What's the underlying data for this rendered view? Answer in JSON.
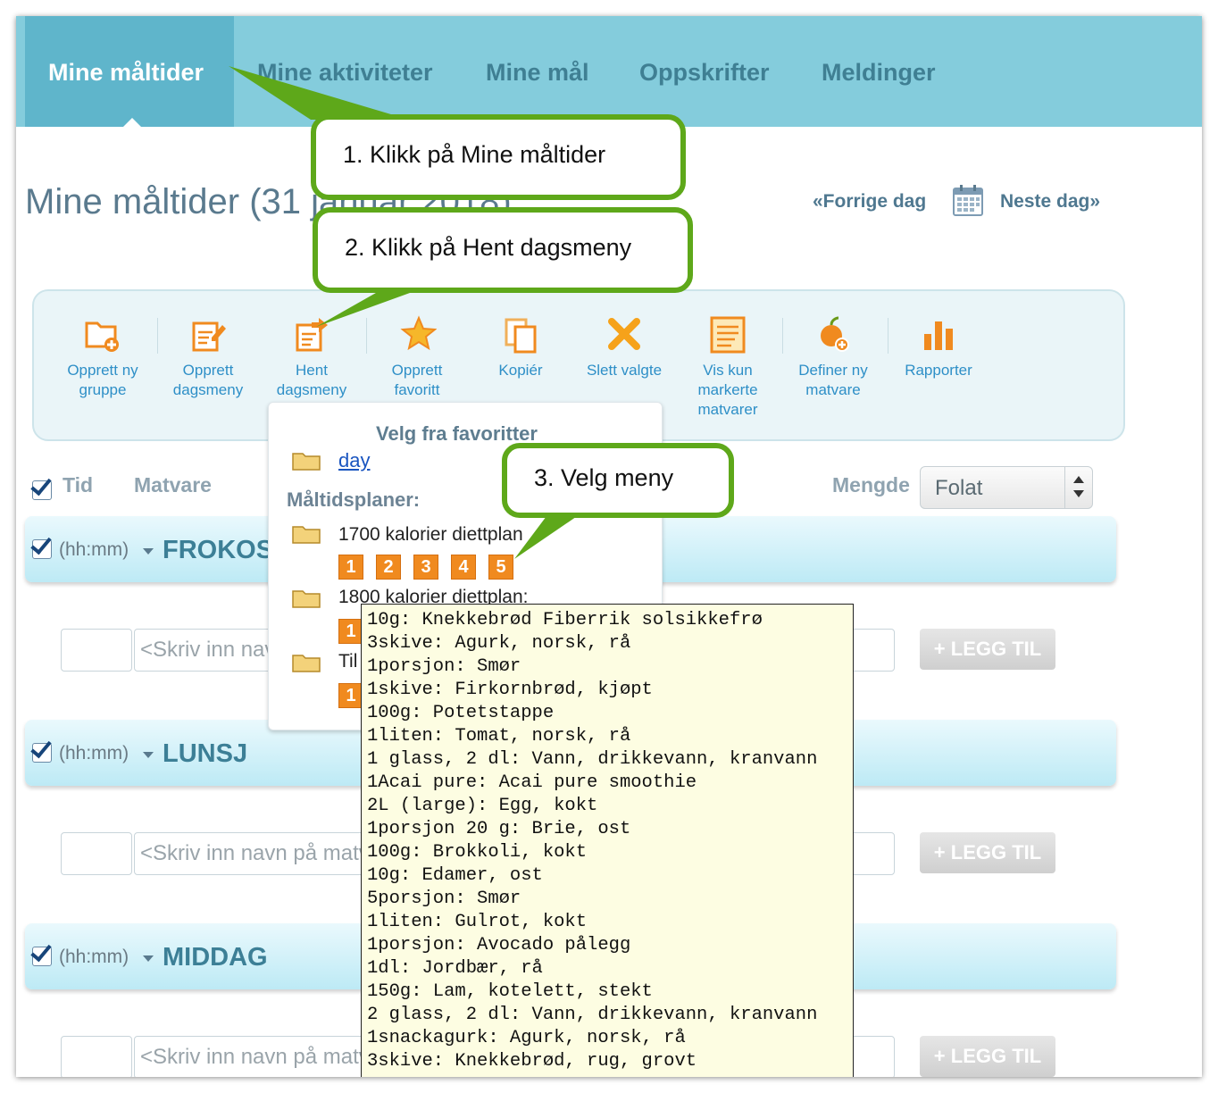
{
  "nav": {
    "tabs": [
      "Mine måltider",
      "Mine aktiviteter",
      "Mine mål",
      "Oppskrifter",
      "Meldinger"
    ]
  },
  "page_title": "Mine måltider (31 januar 2018)",
  "day_nav": {
    "prev": "«Forrige dag",
    "next": "Neste dag»",
    "calendar_icon": "calendar-icon"
  },
  "toolbar": {
    "items": [
      {
        "label": "Opprett ny\ngruppe",
        "icon": "new-folder-icon"
      },
      {
        "label": "Opprett\ndagsmeny",
        "icon": "edit-note-icon"
      },
      {
        "label": "Hent\ndagsmeny",
        "icon": "load-note-icon"
      },
      {
        "label": "Opprett\nfavoritt",
        "icon": "star-icon"
      },
      {
        "label": "Kopiér",
        "icon": "copy-icon"
      },
      {
        "label": "Slett valgte",
        "icon": "delete-x-icon"
      },
      {
        "label": "Vis kun\nmarkerte\nmatvarer",
        "icon": "list-icon"
      },
      {
        "label": "Definer ny\nmatvare",
        "icon": "apple-add-icon"
      },
      {
        "label": "Rapporter",
        "icon": "bar-chart-icon"
      }
    ]
  },
  "list_header": {
    "time": "Tid",
    "food": "Matvare",
    "amount": "Mengde",
    "nutrient_select": "Folat"
  },
  "meals": [
    {
      "time": "(hh:mm)",
      "name": "FROKOST",
      "input_placeholder": "<Skriv inn navn på matvare",
      "add_label": "+ LEGG TIL"
    },
    {
      "time": "(hh:mm)",
      "name": "LUNSJ",
      "input_placeholder": "<Skriv inn navn på matvare",
      "add_label": "+ LEGG TIL"
    },
    {
      "time": "(hh:mm)",
      "name": "MIDDAG",
      "input_placeholder": "<Skriv inn navn på matvare",
      "add_label": "+ LEGG TIL"
    }
  ],
  "favorites_popup": {
    "title": "Velg fra favoritter",
    "favorite": "day",
    "plans_heading": "Måltidsplaner:",
    "plans": [
      {
        "name": "1700 kalorier diettplan",
        "days": [
          "1",
          "2",
          "3",
          "4",
          "5"
        ]
      },
      {
        "name": "1800 kalorier diettplan:",
        "days": [
          "1"
        ]
      },
      {
        "name": "Til",
        "days": [
          "1"
        ]
      }
    ]
  },
  "tooltip_lines": [
    "10g: Knekkebrød Fiberrik solsikkefrø",
    "3skive: Agurk, norsk, rå",
    "1porsjon: Smør",
    "1skive: Firkornbrød, kjøpt",
    "100g: Potetstappe",
    "1liten: Tomat, norsk, rå",
    "1 glass, 2 dl: Vann, drikkevann, kranvann",
    "1Acai pure: Acai pure smoothie",
    "2L (large): Egg, kokt",
    "1porsjon 20 g: Brie, ost",
    "100g: Brokkoli, kokt",
    "10g: Edamer, ost",
    "5porsjon: Smør",
    "1liten: Gulrot, kokt",
    "1porsjon: Avocado pålegg",
    "1dl: Jordbær, rå",
    "150g: Lam, kotelett, stekt",
    "2 glass, 2 dl: Vann, drikkevann, kranvann",
    "1snackagurk: Agurk, norsk, rå",
    "3skive: Knekkebrød, rug, grovt"
  ],
  "callouts": [
    "1. Klikk på Mine måltider",
    "2. Klikk på Hent dagsmeny",
    "3. Velg meny"
  ],
  "colors": {
    "nav_bg": "#84ccdc",
    "nav_active": "#5fb5cb",
    "callout_border": "#5ea81a",
    "accent_orange": "#f08a1f",
    "link_blue": "#2e8fc7"
  }
}
